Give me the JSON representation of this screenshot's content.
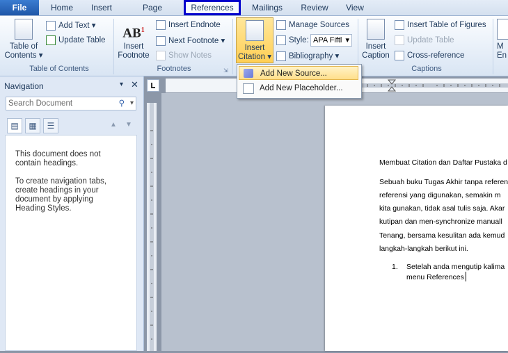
{
  "tabs": {
    "file": "File",
    "home": "Home",
    "insert": "Insert",
    "page_layout": "Page Layout",
    "references": "References",
    "mailings": "Mailings",
    "review": "Review",
    "view": "View"
  },
  "ribbon": {
    "toc": {
      "table_of_contents_1": "Table of",
      "table_of_contents_2": "Contents",
      "add_text": "Add Text",
      "update_table": "Update Table",
      "group": "Table of Contents"
    },
    "footnotes": {
      "insert_footnote_1": "Insert",
      "insert_footnote_2": "Footnote",
      "insert_endnote": "Insert Endnote",
      "next_footnote": "Next Footnote",
      "show_notes": "Show Notes",
      "group": "Footnotes"
    },
    "citations": {
      "insert_citation_1": "Insert",
      "insert_citation_2": "Citation",
      "manage_sources": "Manage Sources",
      "style_label": "Style:",
      "style_value": "APA Fiftl",
      "bibliography": "Bibliography"
    },
    "captions": {
      "insert_caption_1": "Insert",
      "insert_caption_2": "Caption",
      "insert_table_of_figures": "Insert Table of Figures",
      "update_table": "Update Table",
      "cross_reference": "Cross-reference",
      "group": "Captions"
    },
    "cut_off_1": "M",
    "cut_off_2": "En"
  },
  "menu": {
    "add_new_source": "Add New Source...",
    "add_new_placeholder": "Add New Placeholder..."
  },
  "navigation": {
    "title": "Navigation",
    "search_placeholder": "Search Document",
    "no_headings_1": "This document does not",
    "no_headings_2": "contain headings.",
    "hint_1": "To create navigation tabs,",
    "hint_2": "create headings in your",
    "hint_3": "document by applying",
    "hint_4": "Heading Styles."
  },
  "document": {
    "line1": "Membuat Citation dan Daftar Pustaka d",
    "line2": "Sebuah buku Tugas Akhir tanpa referen",
    "line3": "referensi yang digunakan, semakin m",
    "line4": "kita gunakan, tidak asal tulis saja. Akar",
    "line5": "kutipan dan men-synchronize manuall",
    "line6": "Tenang, bersama kesulitan ada kemud",
    "line7": "langkah-langkah berikut ini.",
    "list_number": "1.",
    "list_line1": "Setelah anda mengutip kalima",
    "list_line2": "menu References"
  },
  "colors": {
    "file_tab": "#2a66bd",
    "references_highlight": "#0000cc",
    "menu_hover": "#ffdf8b",
    "insert_citation_active": "#ffcf55"
  }
}
